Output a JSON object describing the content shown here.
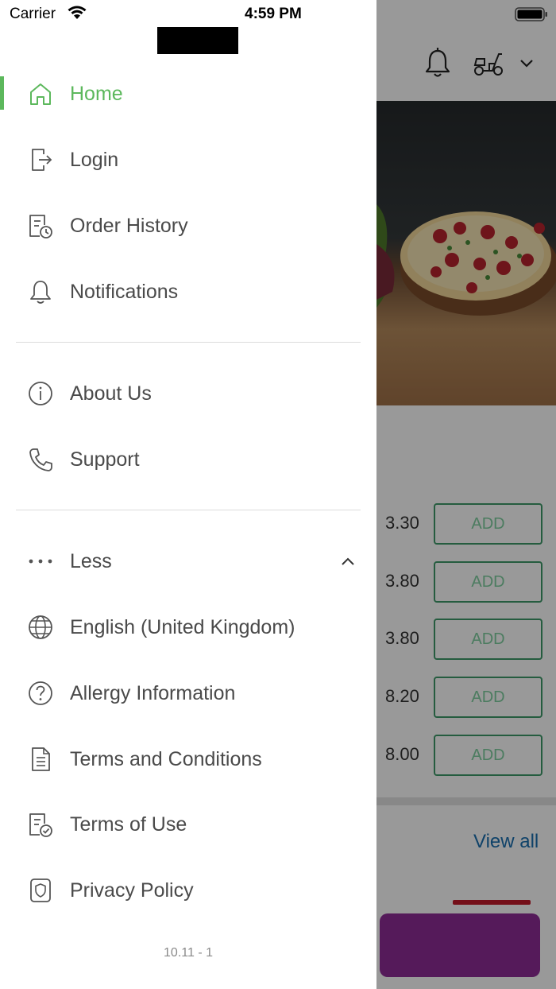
{
  "status_bar": {
    "carrier": "Carrier",
    "time": "4:59 PM"
  },
  "drawer": {
    "primary_items": [
      {
        "label": "Home",
        "icon": "home-icon",
        "active": true
      },
      {
        "label": "Login",
        "icon": "login-icon",
        "active": false
      },
      {
        "label": "Order History",
        "icon": "order-history-icon",
        "active": false
      },
      {
        "label": "Notifications",
        "icon": "bell-icon",
        "active": false
      }
    ],
    "secondary_items": [
      {
        "label": "About Us",
        "icon": "info-icon"
      },
      {
        "label": "Support",
        "icon": "phone-icon"
      }
    ],
    "more_toggle": {
      "label": "Less",
      "icon": "more-dots-icon",
      "expanded": true
    },
    "extra_items": [
      {
        "label": "English (United Kingdom)",
        "icon": "globe-icon"
      },
      {
        "label": "Allergy Information",
        "icon": "question-icon"
      },
      {
        "label": "Terms and Conditions",
        "icon": "document-icon"
      },
      {
        "label": "Terms of Use",
        "icon": "document-check-icon"
      },
      {
        "label": "Privacy Policy",
        "icon": "shield-icon"
      }
    ],
    "version": "10.11 - 1"
  },
  "background": {
    "products": [
      {
        "price": "3.30",
        "button": "ADD"
      },
      {
        "price": "3.80",
        "button": "ADD"
      },
      {
        "price": "3.80",
        "button": "ADD"
      },
      {
        "price": "8.20",
        "button": "ADD"
      },
      {
        "price": "8.00",
        "button": "ADD"
      }
    ],
    "view_all": "View all"
  },
  "colors": {
    "accent": "#5cb85c",
    "text": "#4a4a4a",
    "cart_bar": "#8e2c96",
    "add_border": "#3f9a6a",
    "link": "#1a6fb0"
  }
}
